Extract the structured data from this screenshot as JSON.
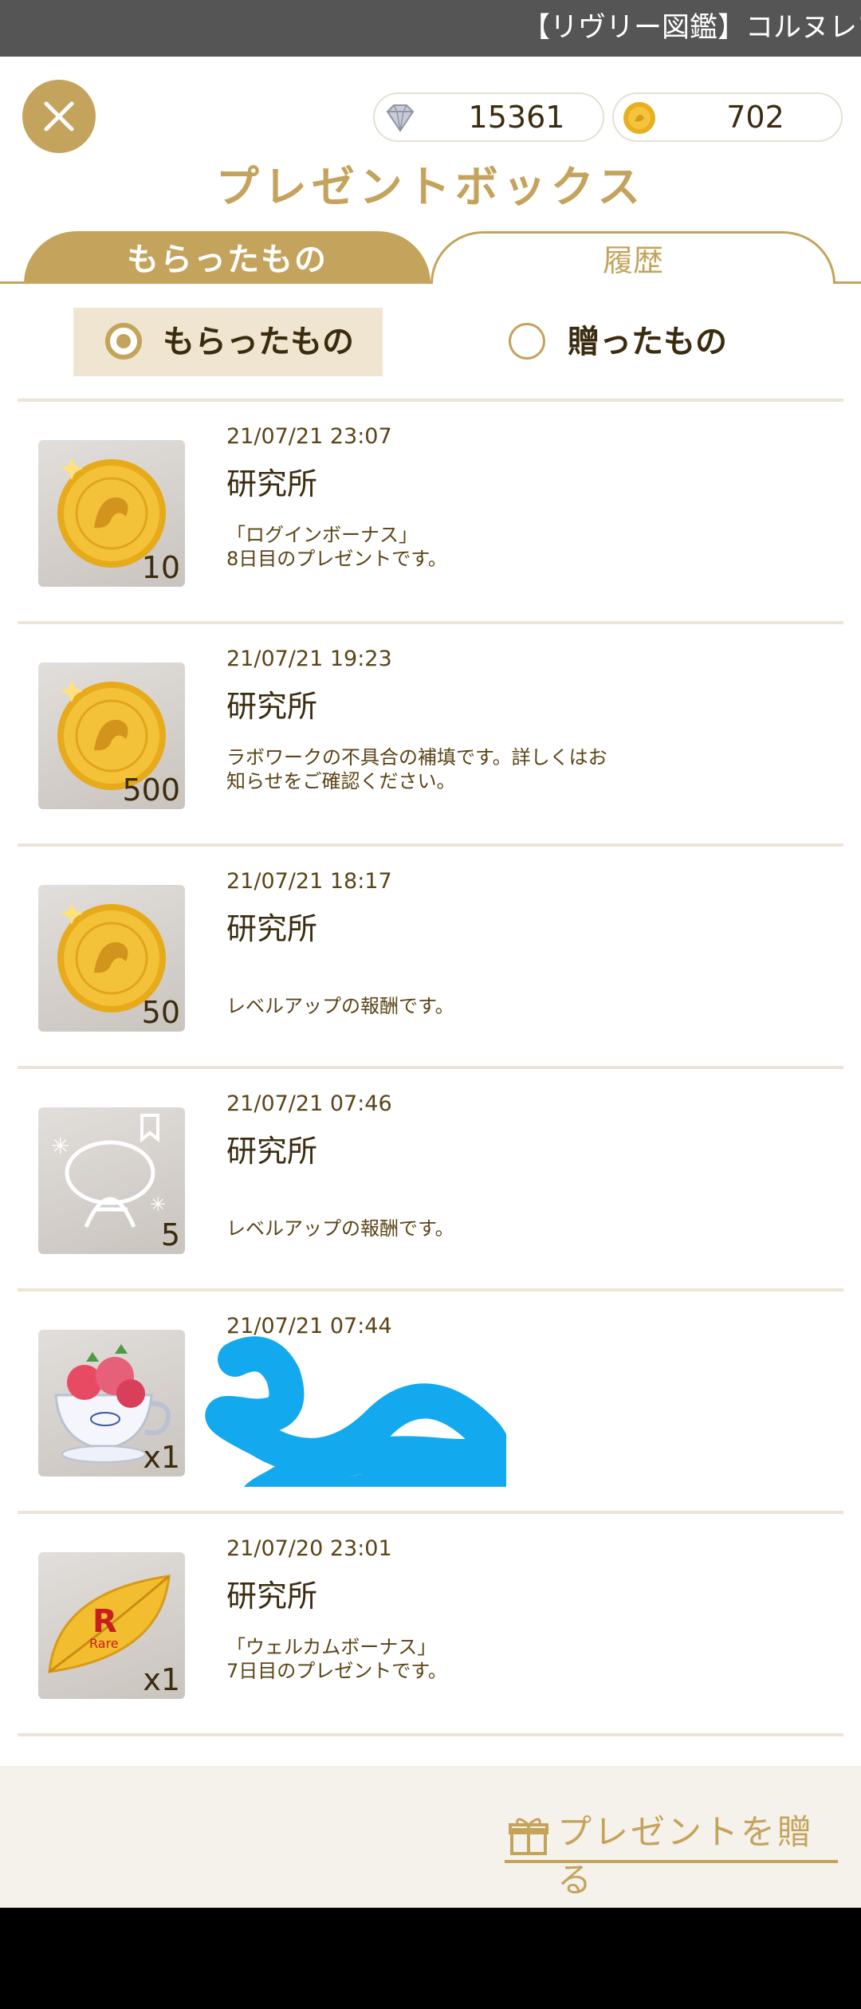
{
  "status_bar": {
    "text": "【リヴリー図鑑】コルヌレプ"
  },
  "header": {
    "gems": "15361",
    "coins": "702",
    "title": "プレゼントボックス"
  },
  "tabs": [
    {
      "label": "もらったもの",
      "active": true
    },
    {
      "label": "履歴",
      "active": false
    }
  ],
  "filter": {
    "options": [
      {
        "label": "もらったもの",
        "selected": true
      },
      {
        "label": "贈ったもの",
        "selected": false
      }
    ]
  },
  "items": [
    {
      "date": "21/07/21 23:07",
      "sender": "研究所",
      "message": "「ログインボーナス」\n8日目のプレゼントです。",
      "qty": "10",
      "icon": "gold-coin-icon"
    },
    {
      "date": "21/07/21 19:23",
      "sender": "研究所",
      "message": "ラボワークの不具合の補填です。詳しくはお\n知らせをご確認ください。",
      "qty": "500",
      "icon": "gold-coin-icon"
    },
    {
      "date": "21/07/21 18:17",
      "sender": "研究所",
      "message": "レベルアップの報酬です。",
      "qty": "50",
      "icon": "gold-coin-icon"
    },
    {
      "date": "21/07/21 07:46",
      "sender": "研究所",
      "message": "レベルアップの報酬です。",
      "qty": "5",
      "icon": "pet-outline-icon"
    },
    {
      "date": "21/07/21 07:44",
      "sender": "",
      "message": "",
      "qty": "x1",
      "icon": "strawberry-teacup-icon"
    },
    {
      "date": "21/07/20 23:01",
      "sender": "研究所",
      "message": "「ウェルカムボーナス」\n7日目のプレゼントです。",
      "qty": "x1",
      "icon": "rare-leaf-icon"
    }
  ],
  "footer": {
    "gift_button": "プレゼントを贈る"
  },
  "colors": {
    "accent": "#c4a45c",
    "text": "#5b4416",
    "divider": "#ece4d6"
  }
}
